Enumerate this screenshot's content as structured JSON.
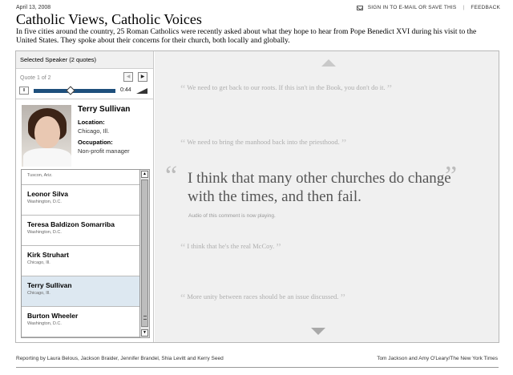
{
  "header": {
    "date": "April 13, 2008",
    "title": "Catholic Views, Catholic Voices",
    "intro": "In five cities around the country, 25 Roman Catholics were recently asked about what they hope to hear from Pope Benedict XVI during his visit to the United States. They spoke about their concerns for their church, both locally and globally.",
    "sign_in": "SIGN IN TO E-MAIL OR SAVE THIS",
    "feedback": "FEEDBACK"
  },
  "left_panel": {
    "selected_speaker": "Selected Speaker (2 quotes)",
    "quote_counter": "Quote 1 of 2",
    "prev_symbol": "◀",
    "next_symbol": "▶",
    "pause_symbol": "II",
    "time": "0:44",
    "player_progress": 0.45,
    "speaker": {
      "name": "Terry Sullivan",
      "location_label": "Location:",
      "location": "Chicago, Ill.",
      "occupation_label": "Occupation:",
      "occupation": "Non-profit manager"
    },
    "list": [
      {
        "name": "",
        "location": "Tuscon, Ariz."
      },
      {
        "name": "Leonor Silva",
        "location": "Washington, D.C."
      },
      {
        "name": "Teresa Baldizon Somarriba",
        "location": "Washington, D.C."
      },
      {
        "name": "Kirk Struhart",
        "location": "Chicago, Ill."
      },
      {
        "name": "Terry Sullivan",
        "location": "Chicago, Ill."
      },
      {
        "name": "Burton Wheeler",
        "location": "Washington, D.C."
      }
    ],
    "scroll_up": "▲",
    "scroll_down": "▼"
  },
  "quotes": {
    "q1": "We need to get back to our roots. If this isn't in the Book, you don't do it.",
    "q2": "We need to bring the manhood back into the priesthood.",
    "main": "I think that many other churches do change with the times, and then fail.",
    "audio_note": "Audio of this comment is now playing.",
    "q4": "I think that he's the real McCoy.",
    "q5": "More unity between races should be an issue discussed.",
    "open_mark": "“",
    "close_mark": "”"
  },
  "footer": {
    "credits": "Reporting by Laura Belous, Jackson Braider, Jennifer Brandel, Shia Levitt and Kerry Seed",
    "photo_credit": "Tom Jackson and Amy O'Leary/The New York Times"
  },
  "colors": {
    "accent": "#1e4f7c",
    "active_row": "#dde8f1",
    "panel_bg": "#f0f0f0"
  }
}
